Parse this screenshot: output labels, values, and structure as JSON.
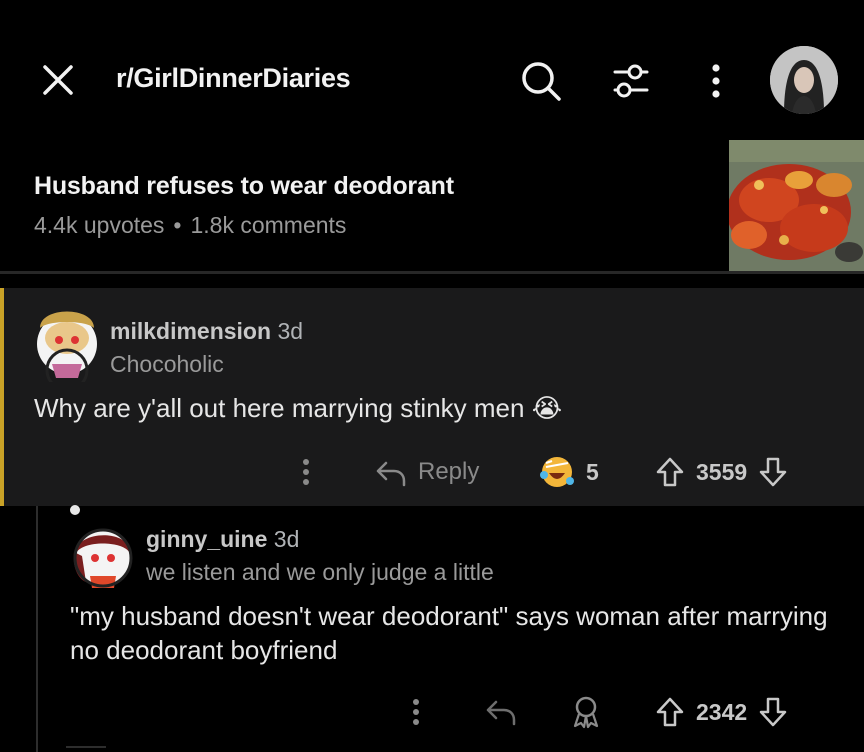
{
  "header": {
    "subreddit": "r/GirlDinnerDiaries",
    "icons": {
      "close": "close-icon",
      "search": "search-icon",
      "filter": "filter-icon",
      "more": "more-vertical-icon"
    }
  },
  "post": {
    "title": "Husband refuses to wear deodorant",
    "upvotes": "4.4k upvotes",
    "separator": "•",
    "comments": "1.8k comments"
  },
  "comments": [
    {
      "username": "milkdimension",
      "age": "3d",
      "flair": "Chocoholic",
      "body": "Why are y'all out here marrying stinky men",
      "emoji": "😭",
      "reply_label": "Reply",
      "award_count": "5",
      "score": "3559"
    },
    {
      "username": "ginny_uine",
      "age": "3d",
      "flair": "we listen and we only judge a little",
      "body": "\"my husband doesn't wear deodorant\" says woman after marrying no deodorant boyfriend",
      "score": "2342"
    }
  ],
  "colors": {
    "accent_bar": "#c9a227",
    "background": "#000000",
    "comment_bg": "#1a1a1b"
  }
}
